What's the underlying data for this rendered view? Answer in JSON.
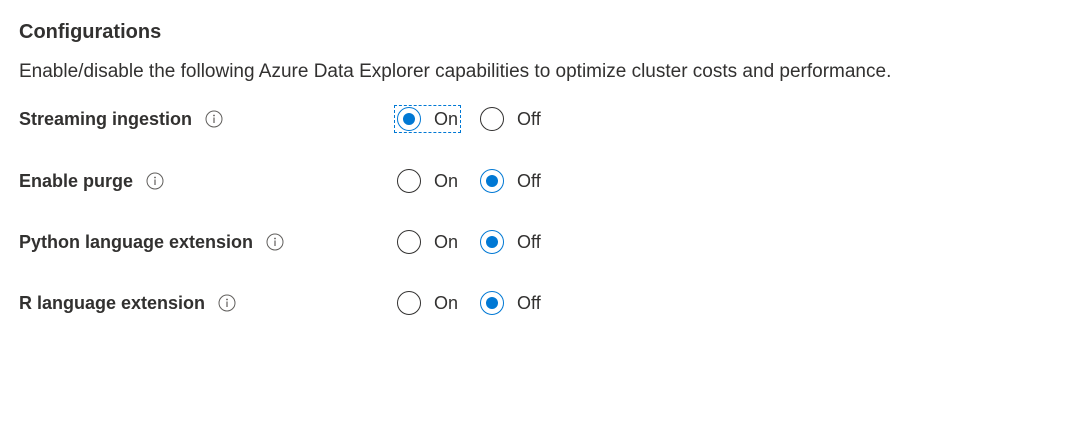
{
  "section": {
    "title": "Configurations",
    "description": "Enable/disable the following Azure Data Explorer capabilities to optimize cluster costs and performance."
  },
  "settings": [
    {
      "label": "Streaming ingestion",
      "icon": "info-icon",
      "options": [
        {
          "label": "On",
          "checked": true,
          "focused": true
        },
        {
          "label": "Off",
          "checked": false,
          "focused": false
        }
      ]
    },
    {
      "label": "Enable purge",
      "icon": "info-icon",
      "options": [
        {
          "label": "On",
          "checked": false,
          "focused": false
        },
        {
          "label": "Off",
          "checked": true,
          "focused": false
        }
      ]
    },
    {
      "label": "Python language extension",
      "icon": "info-icon",
      "options": [
        {
          "label": "On",
          "checked": false,
          "focused": false
        },
        {
          "label": "Off",
          "checked": true,
          "focused": false
        }
      ]
    },
    {
      "label": "R language extension",
      "icon": "info-icon",
      "options": [
        {
          "label": "On",
          "checked": false,
          "focused": false
        },
        {
          "label": "Off",
          "checked": true,
          "focused": false
        }
      ]
    }
  ],
  "colors": {
    "accent": "#0078d4",
    "text": "#323130",
    "icon": "#605e5c"
  }
}
